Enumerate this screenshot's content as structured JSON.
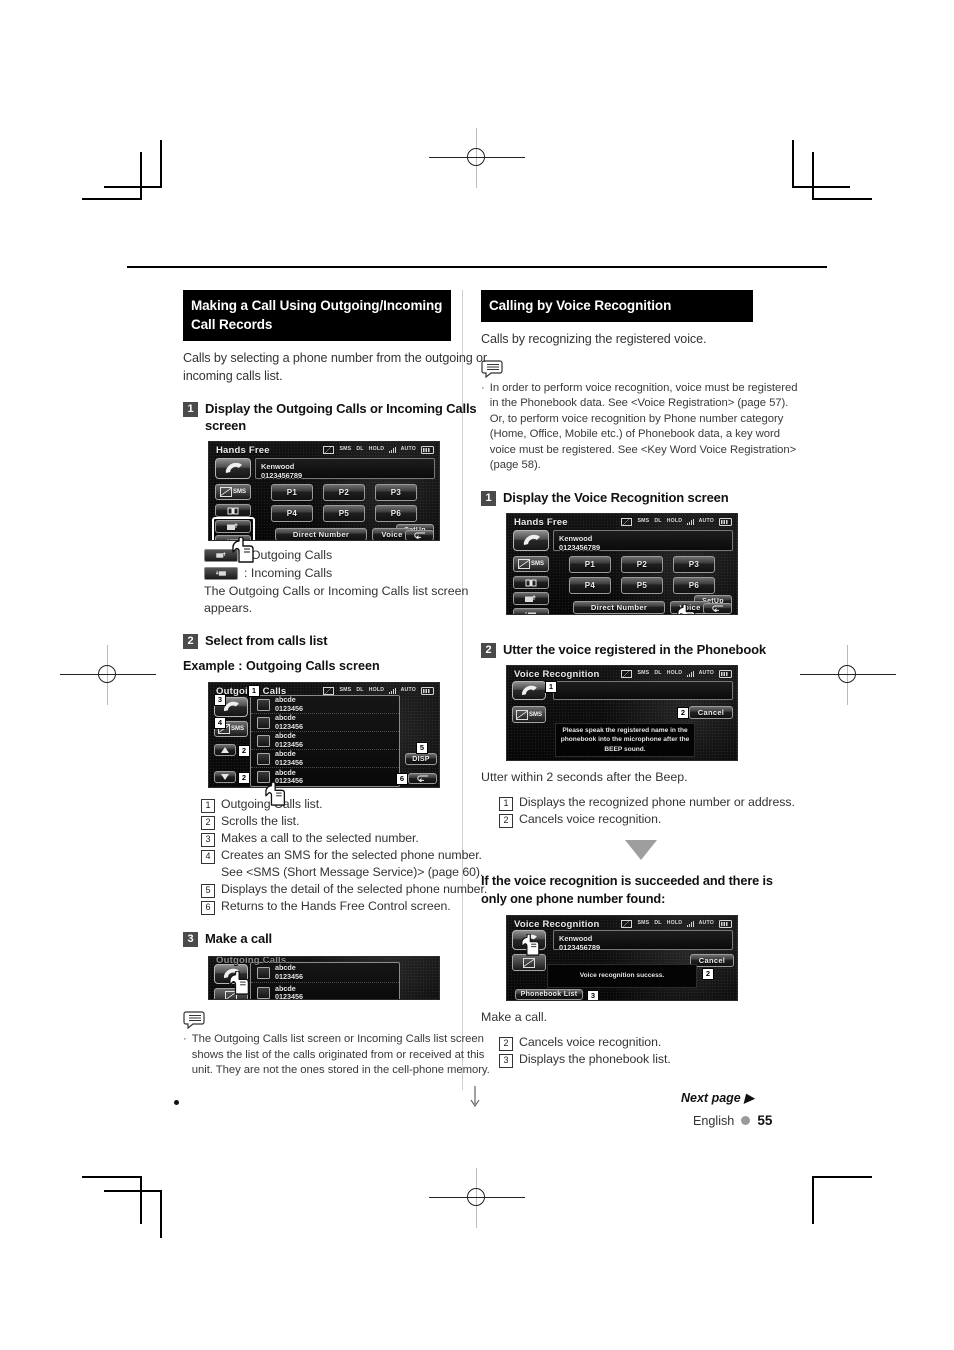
{
  "page": {
    "language": "English",
    "number": "55",
    "next_page": "Next page",
    "next_page_arrow": "▶"
  },
  "left_column": {
    "section_title": "Making a Call Using Outgoing/Incoming Call Records",
    "intro": "Calls by selecting a phone number from the outgoing or incoming calls list.",
    "step1": {
      "num": "1",
      "label": "Display the Outgoing Calls or Incoming Calls screen",
      "screen": {
        "title": "Hands Free",
        "caller_name": "Kenwood",
        "caller_number": "0123456789",
        "presets": [
          "P1",
          "P2",
          "P3",
          "P4",
          "P5",
          "P6"
        ],
        "setup_label": "SetUp",
        "direct_number_label": "Direct Number",
        "voice_label": "Voice",
        "sms_label": "SMS",
        "status_icons": [
          "sms-icon",
          "DL",
          "HOLD",
          "signal-icon",
          "AUTO",
          "battery-icon"
        ]
      },
      "legend": [
        {
          "icon": "outgoing-calls-icon",
          "text": ": Outgoing Calls"
        },
        {
          "icon": "incoming-calls-icon",
          "text": ": Incoming Calls"
        }
      ],
      "legend_note": "The Outgoing Calls or Incoming Calls list screen appears."
    },
    "step2": {
      "num": "2",
      "label": "Select from calls list",
      "example_label": "Example : Outgoing Calls screen",
      "screen": {
        "title": "Outgoing Calls",
        "disp_label": "DISP",
        "entries": [
          {
            "name": "abcde",
            "number": "0123456"
          },
          {
            "name": "abcde",
            "number": "0123456"
          },
          {
            "name": "abcde",
            "number": "0123456"
          },
          {
            "name": "abcde",
            "number": "0123456"
          },
          {
            "name": "abcde",
            "number": "0123456"
          }
        ],
        "sms_label": "SMS"
      },
      "definitions": [
        {
          "num": "1",
          "text": "Outgoing Calls list."
        },
        {
          "num": "2",
          "text": "Scrolls the list."
        },
        {
          "num": "3",
          "text": "Makes a call to the selected number."
        },
        {
          "num": "4",
          "text": "Creates an SMS for the selected phone number. See <SMS (Short Message Service)> (page 60)."
        },
        {
          "num": "5",
          "text": "Displays the detail of the selected phone number."
        },
        {
          "num": "6",
          "text": "Returns to the Hands Free Control screen."
        }
      ]
    },
    "step3": {
      "num": "3",
      "label": "Make a call",
      "screen": {
        "title": "Outgoing Calls",
        "entries": [
          {
            "name": "abcde",
            "number": "0123456"
          },
          {
            "name": "abcde",
            "number": "0123456"
          }
        ]
      }
    },
    "footnote": [
      "The Outgoing Calls list screen or Incoming Calls list screen shows the list of the calls originated from or received at this unit. They are not the ones stored in the cell-phone memory."
    ],
    "bullet": "·"
  },
  "right_column": {
    "section_title": "Calling by Voice Recognition",
    "intro": "Calls by recognizing the registered voice.",
    "notes": [
      "In order to perform voice recognition, voice must be registered in the Phonebook data. See <Voice Registration> (page 57). Or, to perform voice recognition by Phone number category (Home, Office, Mobile etc.) of Phonebook data, a key word voice must be registered. See <Key Word Voice Registration> (page 58)."
    ],
    "bullet": "·",
    "step1": {
      "num": "1",
      "label": "Display the Voice Recognition screen",
      "screen": {
        "title": "Hands Free",
        "caller_name": "Kenwood",
        "caller_number": "0123456789",
        "presets": [
          "P1",
          "P2",
          "P3",
          "P4",
          "P5",
          "P6"
        ],
        "setup_label": "SetUp",
        "direct_number_label": "Direct Number",
        "voice_label": "Voice",
        "sms_label": "SMS"
      }
    },
    "step2": {
      "num": "2",
      "label": "Utter the voice registered in the Phonebook",
      "screen": {
        "title": "Voice Recognition",
        "cancel_label": "Cancel",
        "sms_label": "SMS",
        "dialog_text": "Please speak the registered name in the phonebook into the microphone after the BEEP sound."
      },
      "caption": "Utter within 2 seconds after the Beep.",
      "definitions": [
        {
          "num": "1",
          "text": "Displays the recognized phone number or address."
        },
        {
          "num": "2",
          "text": "Cancels voice recognition."
        }
      ]
    },
    "success": {
      "heading": "If the voice recognition is succeeded and there is only one phone number found:",
      "screen": {
        "title": "Voice Recognition",
        "caller_name": "Kenwood",
        "caller_number": "0123456789",
        "cancel_label": "Cancel",
        "dialog_text": "Voice recognition success.",
        "phonebook_list_label": "Phonebook List"
      },
      "caption": "Make a call.",
      "definitions": [
        {
          "num": "2",
          "text": "Cancels voice recognition."
        },
        {
          "num": "3",
          "text": "Displays the phonebook list."
        }
      ]
    }
  }
}
